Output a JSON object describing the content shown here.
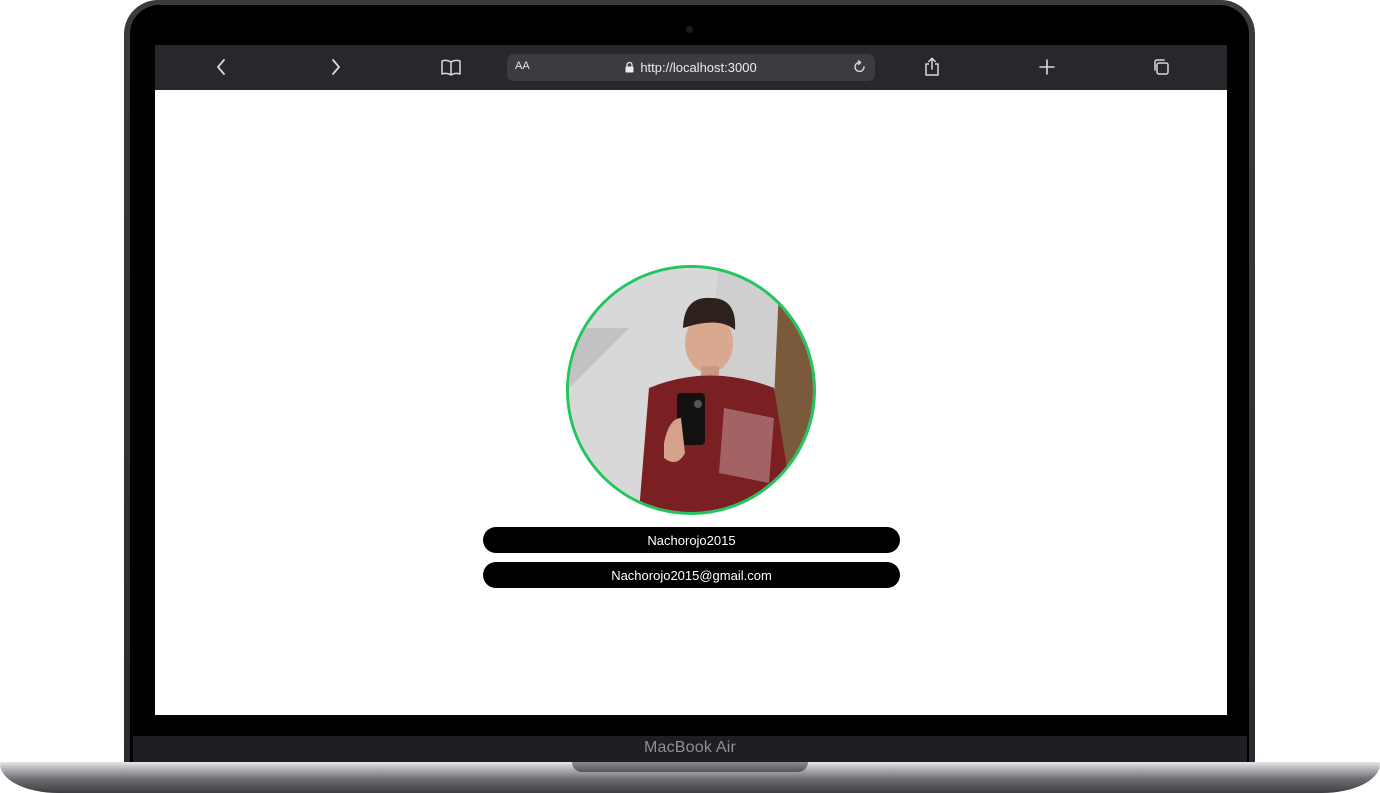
{
  "device": {
    "label": "MacBook Air"
  },
  "browser": {
    "text_size_label": "AA",
    "url": "http://localhost:3000"
  },
  "page": {
    "nav_icons": [
      "home-icon",
      "moon-icon"
    ],
    "username": "Nachorojo2015",
    "email": "Nachorojo2015@gmail.com",
    "colors": {
      "avatar_border": "#22c55e",
      "pill_bg": "#000000",
      "pill_text": "#ffffff"
    }
  }
}
